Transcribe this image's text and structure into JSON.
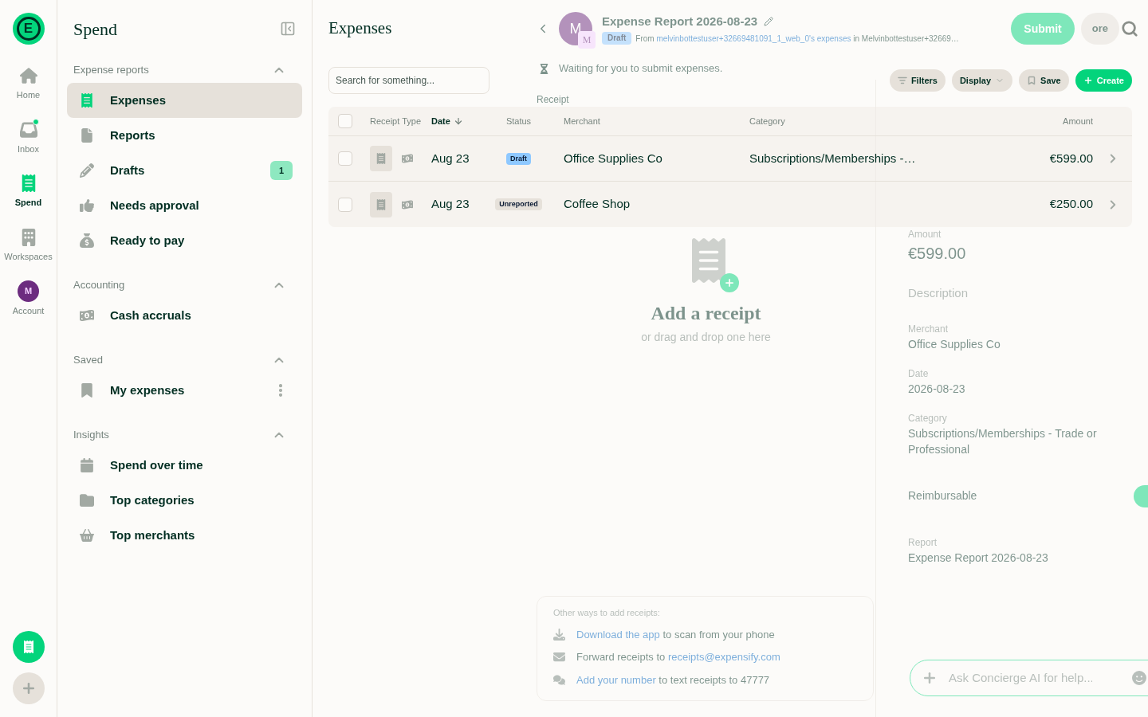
{
  "rail": {
    "logo": "E",
    "items": [
      {
        "kind": "home",
        "label": "Home",
        "selected": false,
        "unread": false
      },
      {
        "kind": "inbox",
        "label": "Inbox",
        "selected": false,
        "unread": true
      },
      {
        "kind": "spend",
        "label": "Spend",
        "selected": true,
        "unread": false
      },
      {
        "kind": "workspaces",
        "label": "Workspaces",
        "selected": false,
        "unread": false
      },
      {
        "kind": "account",
        "label": "Account",
        "selected": false,
        "unread": false,
        "avatar": "M"
      }
    ]
  },
  "sidebar": {
    "title": "Spend",
    "sections": [
      {
        "title": "Expense reports",
        "expanded": true,
        "items": [
          {
            "kind": "expenses",
            "label": "Expenses",
            "selected": true
          },
          {
            "kind": "reports",
            "label": "Reports",
            "selected": false
          },
          {
            "kind": "drafts",
            "label": "Drafts",
            "selected": false,
            "badge": "1"
          },
          {
            "kind": "approval",
            "label": "Needs approval",
            "selected": false
          },
          {
            "kind": "pay",
            "label": "Ready to pay",
            "selected": false
          }
        ]
      },
      {
        "title": "Accounting",
        "expanded": true,
        "items": [
          {
            "kind": "accruals",
            "label": "Cash accruals",
            "selected": false
          }
        ]
      },
      {
        "title": "Saved",
        "expanded": true,
        "items": [
          {
            "kind": "saved",
            "label": "My expenses",
            "selected": false,
            "menu": true
          }
        ]
      },
      {
        "title": "Insights",
        "expanded": true,
        "items": [
          {
            "kind": "time",
            "label": "Spend over time",
            "selected": false
          },
          {
            "kind": "categories",
            "label": "Top categories",
            "selected": false
          },
          {
            "kind": "merchants",
            "label": "Top merchants",
            "selected": false
          }
        ]
      }
    ]
  },
  "main": {
    "title": "Expenses",
    "search": {
      "placeholder": "Search for something..."
    },
    "buttons": [
      {
        "kind": "filters",
        "label": "Filters"
      },
      {
        "kind": "display",
        "label": "Display"
      },
      {
        "kind": "save",
        "label": "Save"
      },
      {
        "kind": "create",
        "label": "Create"
      }
    ],
    "table": {
      "all_checked": false,
      "columns": [
        {
          "kind": "receipt",
          "label": "Receipt Type"
        },
        {
          "kind": "date",
          "label": "Date",
          "sorted": true
        },
        {
          "kind": "status",
          "label": "Status"
        },
        {
          "kind": "merchant",
          "label": "Merchant"
        },
        {
          "kind": "category",
          "label": "Category"
        },
        {
          "kind": "amount",
          "label": "Amount"
        }
      ],
      "rows": [
        {
          "checked": false,
          "date": "Aug 23",
          "status": "Draft",
          "color": "#8ec8ff",
          "merchant": "Office Supplies Co",
          "category": "Subscriptions/Memberships -…",
          "amount": "€599.00"
        },
        {
          "checked": false,
          "date": "Aug 23",
          "status": "Unreported",
          "color": "#e6e1da",
          "merchant": "Coffee Shop",
          "amount": "€250.00"
        }
      ]
    }
  },
  "background_report": {
    "avatar": "M",
    "avatar_badge": "M",
    "title": "Expense Report 2026-08-23",
    "status": "Draft",
    "from": [
      {
        "text": "From ",
        "link": false
      },
      {
        "text": "melvinbottestuser+32669481091_1_web_0's expenses",
        "link": true
      },
      {
        "text": " in Melvinbottestuser+32669…",
        "link": false
      }
    ],
    "submit": "Submit",
    "more": "ore",
    "waiting": "Waiting for you to submit expenses.",
    "receipt_label": "Receipt",
    "add_title": "Add a receipt",
    "add_hint": "or drag and drop one here",
    "other_title": "Other ways to add receipts:",
    "other_ways": [
      {
        "kind": "download",
        "parts": [
          {
            "text": "Download the app",
            "link": true
          },
          {
            "text": " to scan from your phone",
            "link": false
          }
        ]
      },
      {
        "kind": "mail",
        "parts": [
          {
            "text": "Forward receipts to ",
            "link": false
          },
          {
            "text": "receipts@expensify.com",
            "link": true
          }
        ]
      },
      {
        "kind": "chat",
        "parts": [
          {
            "text": "Add your number",
            "link": true
          },
          {
            "text": " to text receipts to 47777",
            "link": false
          }
        ]
      }
    ],
    "fields": [
      {
        "kind": "amount",
        "label": "Amount",
        "value": "€599.00"
      },
      {
        "kind": "text",
        "label": "Description"
      },
      {
        "kind": "text",
        "label": "Merchant",
        "value": "Office Supplies Co"
      },
      {
        "kind": "text",
        "label": "Date",
        "value": "2026-08-23"
      },
      {
        "kind": "text",
        "label": "Category",
        "value": "Subscriptions/Memberships - Trade or Professional"
      },
      {
        "kind": "toggle",
        "label": "Reimbursable",
        "on": true
      },
      {
        "kind": "text",
        "label": "Report",
        "value": "Expense Report 2026-08-23"
      }
    ],
    "composer": {
      "placeholder": "Ask Concierge AI for help..."
    }
  }
}
